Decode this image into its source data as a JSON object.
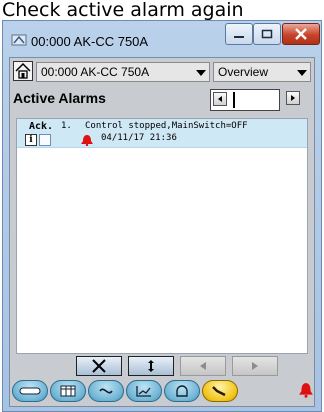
{
  "caption": "Check active alarm again",
  "window": {
    "title": "00:000 AK-CC 750A"
  },
  "toolbar": {
    "device_combo_value": "00:000 AK-CC 750A",
    "view_combo_value": "Overview"
  },
  "page": {
    "title": "Active Alarms"
  },
  "alarms": [
    {
      "ack_label": "Ack.",
      "number": "1.",
      "message": "Control stopped,MainSwitch=OFF",
      "timestamp": "04/11/17 21:36",
      "info_label": "i"
    }
  ],
  "colors": {
    "selected_row": "#cfe8f5",
    "alarm_red": "#e01010",
    "active_nav": "#f2c418",
    "nav_blue": "#6fb4d4",
    "close_red": "#c7432a"
  },
  "icons": {
    "home": "home-icon",
    "alarm": "alarm-bell-icon",
    "nav": [
      "equipment-icon",
      "table-icon",
      "fan-icon",
      "graph-icon",
      "service-icon",
      "wrench-icon"
    ]
  }
}
